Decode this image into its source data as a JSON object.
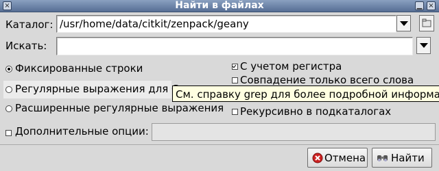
{
  "window": {
    "title": "Найти в файлах"
  },
  "catalog": {
    "label": "Каталог:",
    "value": "/usr/home/data/citkit/zenpack/geany"
  },
  "search": {
    "label": "Искать:",
    "value": ""
  },
  "options": {
    "fixed": "Фиксированные строки",
    "regex": "Регулярные выражения для Grep",
    "extended": "Расширенные регулярные выражения",
    "case": "С учетом регистра",
    "whole_word": "Совпадение только всего слова",
    "recursive": "Рекурсивно в подкаталогах",
    "extra": "Дополнительные опции:"
  },
  "tooltip": "См. справку grep для более подробной информации.",
  "buttons": {
    "cancel": "Отмена",
    "find": "Найти"
  },
  "colors": {
    "titlebar": "#566e94",
    "tooltip_bg": "#ffffe1",
    "cancel_icon": "#cc2222"
  },
  "icons": [
    "close-icon",
    "folder-open-icon",
    "cancel-icon",
    "binoculars-icon"
  ]
}
